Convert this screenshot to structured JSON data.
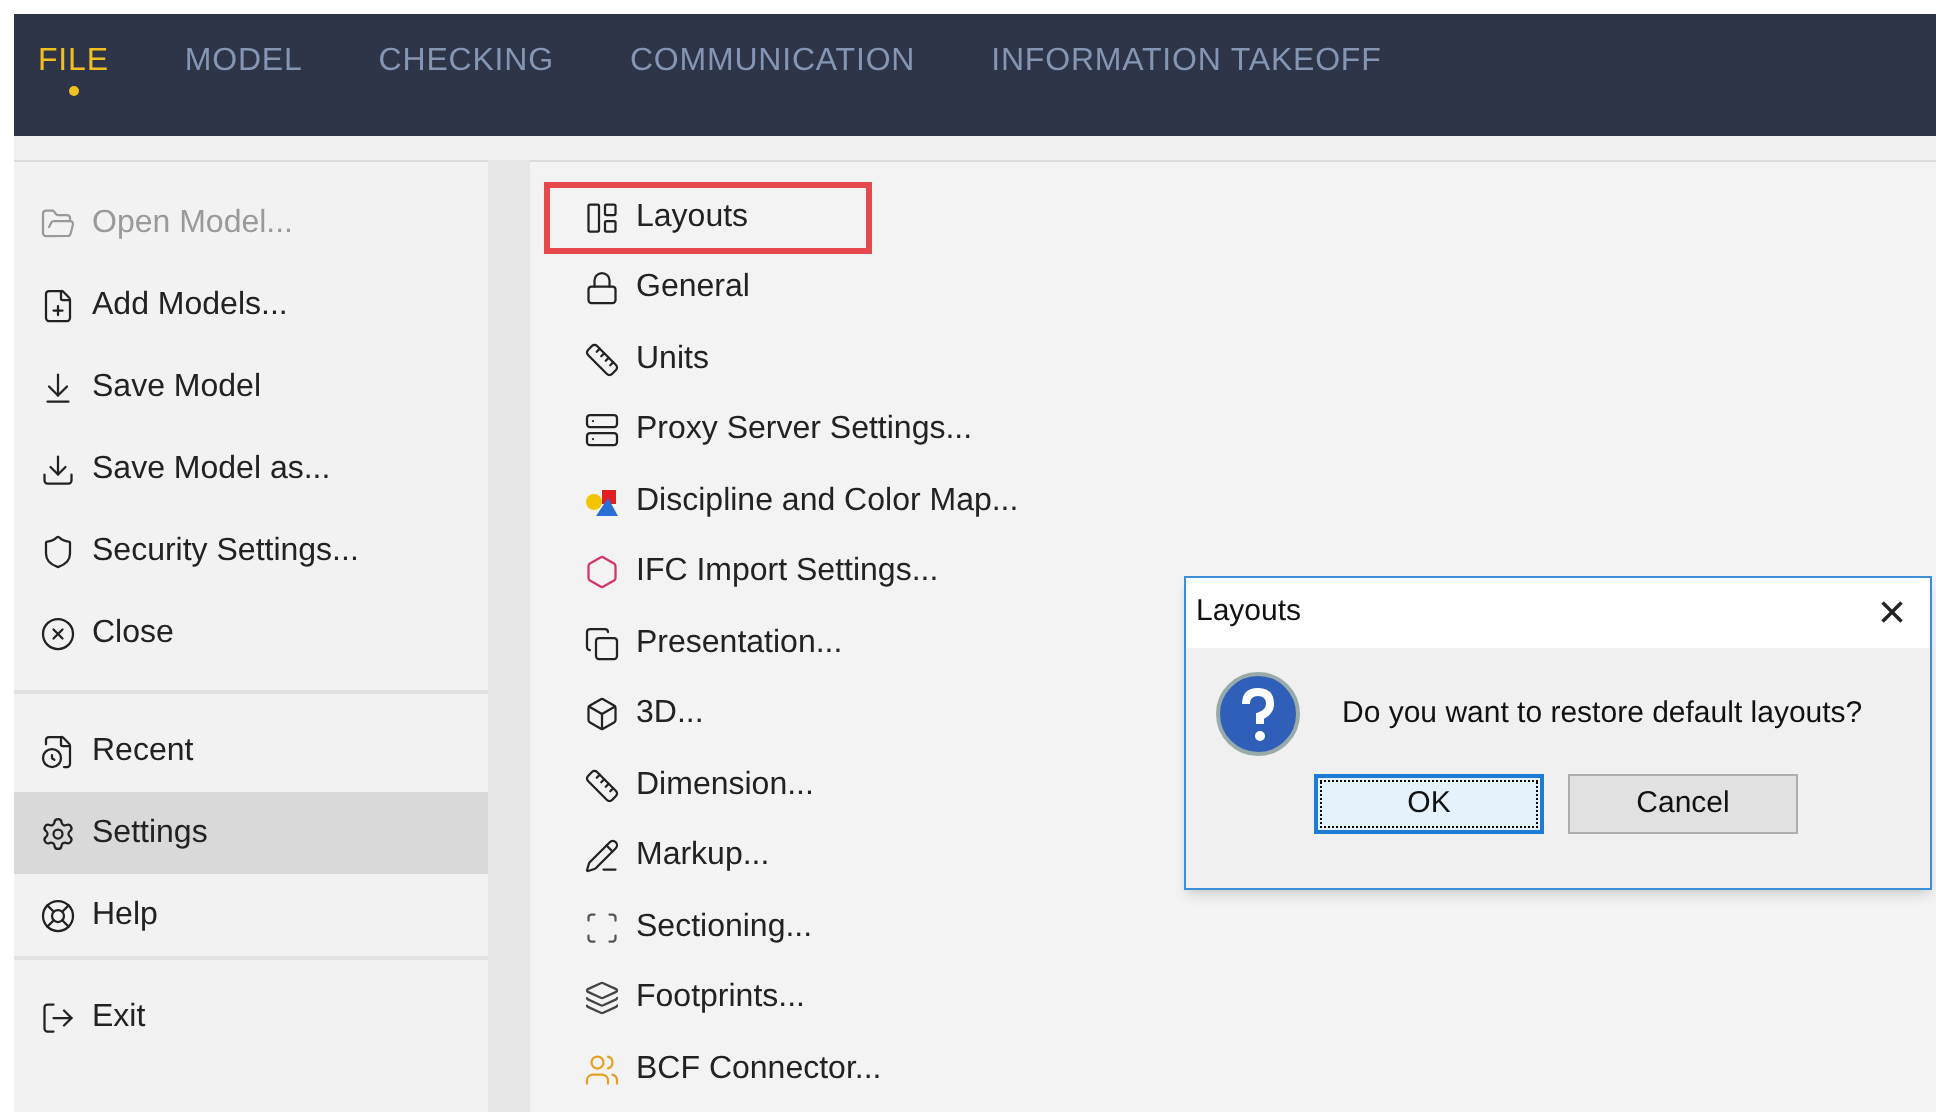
{
  "menu_tabs": [
    {
      "label": "FILE",
      "selected": true
    },
    {
      "label": "MODEL",
      "selected": false
    },
    {
      "label": "CHECKING",
      "selected": false
    },
    {
      "label": "COMMUNICATION",
      "selected": false
    },
    {
      "label": "INFORMATION TAKEOFF",
      "selected": false
    }
  ],
  "sidebar": {
    "groups": [
      [
        {
          "label": "Open Model...",
          "disabled": true,
          "selected": false
        },
        {
          "label": "Add Models...",
          "disabled": false,
          "selected": false
        },
        {
          "label": "Save Model",
          "disabled": false,
          "selected": false
        },
        {
          "label": "Save Model as...",
          "disabled": false,
          "selected": false
        },
        {
          "label": "Security Settings...",
          "disabled": false,
          "selected": false
        },
        {
          "label": "Close",
          "disabled": false,
          "selected": false
        }
      ],
      [
        {
          "label": "Recent",
          "disabled": false,
          "selected": false
        },
        {
          "label": "Settings",
          "disabled": false,
          "selected": true
        },
        {
          "label": "Help",
          "disabled": false,
          "selected": false
        }
      ],
      [
        {
          "label": "Exit",
          "disabled": false,
          "selected": false
        }
      ]
    ]
  },
  "settings_list": [
    {
      "label": "Layouts",
      "highlighted": true
    },
    {
      "label": "General",
      "highlighted": false
    },
    {
      "label": "Units",
      "highlighted": false
    },
    {
      "label": "Proxy Server Settings...",
      "highlighted": false
    },
    {
      "label": "Discipline and Color Map...",
      "highlighted": false
    },
    {
      "label": "IFC Import Settings...",
      "highlighted": false
    },
    {
      "label": "Presentation...",
      "highlighted": false
    },
    {
      "label": "3D...",
      "highlighted": false
    },
    {
      "label": "Dimension...",
      "highlighted": false
    },
    {
      "label": "Markup...",
      "highlighted": false
    },
    {
      "label": "Sectioning...",
      "highlighted": false
    },
    {
      "label": "Footprints...",
      "highlighted": false
    },
    {
      "label": "BCF Connector...",
      "highlighted": false
    }
  ],
  "dialog": {
    "title": "Layouts",
    "close": "×",
    "message": "Do you want to restore default layouts?",
    "buttons": [
      {
        "label": "OK",
        "selected": true
      },
      {
        "label": "Cancel",
        "selected": false
      }
    ]
  }
}
